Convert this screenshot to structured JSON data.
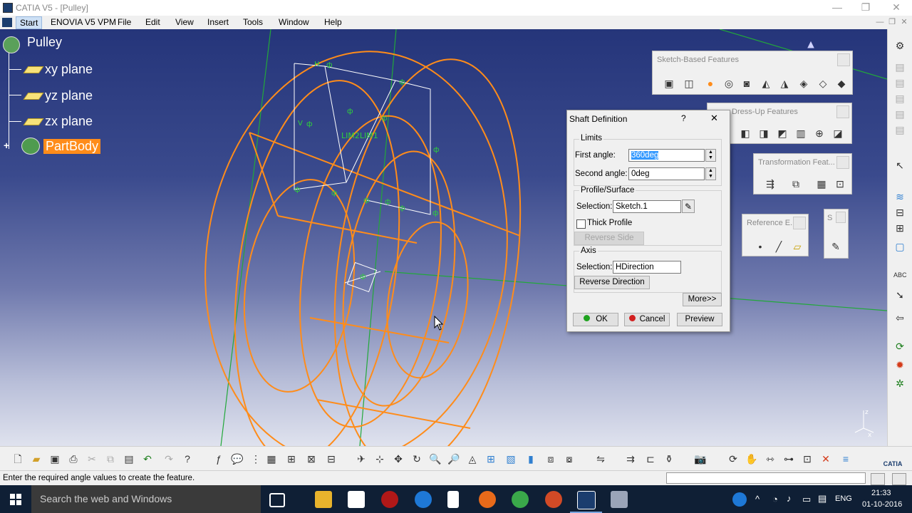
{
  "window": {
    "title": "CATIA V5 - [Pulley]",
    "controls": [
      "—",
      "❐",
      "✕"
    ]
  },
  "menu": {
    "items": [
      "Start",
      "ENOVIA V5 VPM",
      "File",
      "Edit",
      "View",
      "Insert",
      "Tools",
      "Window",
      "Help"
    ],
    "mdi_controls": [
      "—",
      "❐",
      "✕"
    ]
  },
  "tree": {
    "root": "Pulley",
    "planes": [
      "xy plane",
      "yz plane",
      "zx plane"
    ],
    "body": "PartBody",
    "expand_symbol": "+"
  },
  "viewport": {
    "sketch_label": "LIM2LIM1",
    "axis_labels": {
      "z": "z",
      "x": "x"
    }
  },
  "toolbars": {
    "sketch_based": {
      "title": "Sketch-Based Features"
    },
    "dress_up": {
      "title": "Dress-Up Features"
    },
    "transformation": {
      "title": "Transformation Feat..."
    },
    "reference": {
      "title": "Reference E..."
    },
    "small": {
      "title": "S"
    }
  },
  "dialog": {
    "title": "Shaft Definition",
    "help": "?",
    "close": "✕",
    "limits": {
      "label": "Limits",
      "first_angle_label": "First angle:",
      "first_angle_value": "360deg",
      "second_angle_label": "Second angle:",
      "second_angle_value": "0deg"
    },
    "profile": {
      "label": "Profile/Surface",
      "selection_label": "Selection:",
      "selection_value": "Sketch.1",
      "thick_profile_label": "Thick Profile",
      "thick_profile_checked": false,
      "reverse_side_label": "Reverse Side"
    },
    "axis": {
      "label": "Axis",
      "selection_label": "Selection:",
      "selection_value": "HDirection",
      "reverse_direction_label": "Reverse Direction"
    },
    "more_label": "More>>",
    "ok_label": "OK",
    "cancel_label": "Cancel",
    "preview_label": "Preview"
  },
  "status": {
    "message": "Enter the required angle values to create the feature."
  },
  "taskbar": {
    "search_placeholder": "Search the web and Windows",
    "language": "ENG",
    "time": "21:33",
    "date": "01-10-2016"
  },
  "colors": {
    "geometry": "#ff8c1a",
    "axis_lines": "#22a83a",
    "selection": "#ff8c1a",
    "viewport_top": "#25357a",
    "viewport_bottom": "#dfe2ee"
  }
}
